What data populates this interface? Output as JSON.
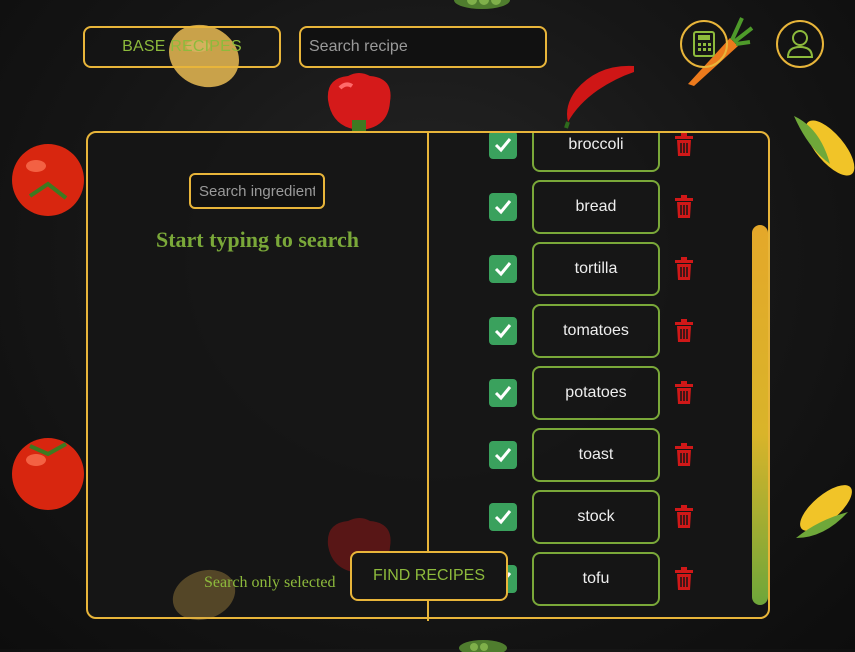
{
  "header": {
    "base_recipes_label": "BASE RECIPES",
    "search_placeholder": "Search recipe"
  },
  "left_panel": {
    "ingredient_search_placeholder": "Search ingredient",
    "empty_message": "Start typing to search",
    "search_only_selected_label": "Search only selected"
  },
  "find_recipes_label": "FIND RECIPES",
  "ingredients": [
    {
      "label": "broccoli",
      "checked": true
    },
    {
      "label": "bread",
      "checked": true
    },
    {
      "label": "tortilla",
      "checked": true
    },
    {
      "label": "tomatoes",
      "checked": true
    },
    {
      "label": "potatoes",
      "checked": true
    },
    {
      "label": "toast",
      "checked": true
    },
    {
      "label": "stock",
      "checked": true
    },
    {
      "label": "tofu",
      "checked": true
    }
  ],
  "icons": {
    "calculator": "calculator-icon",
    "profile": "user-icon",
    "delete": "trash-icon",
    "check": "check-icon"
  },
  "colors": {
    "accent_gold": "#e8b53a",
    "accent_green": "#8dba3c",
    "checkbox_green": "#3aa15d",
    "delete_red": "#d01818"
  }
}
